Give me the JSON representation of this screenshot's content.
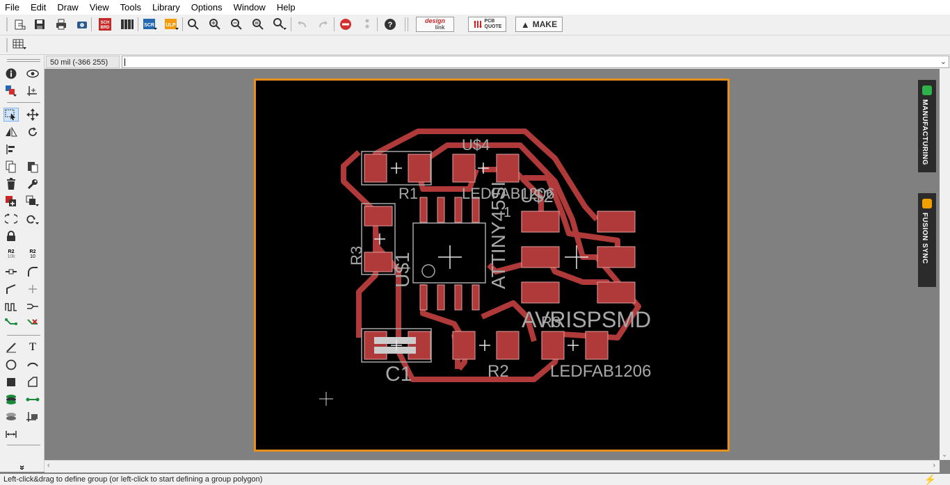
{
  "menu": [
    "File",
    "Edit",
    "Draw",
    "View",
    "Tools",
    "Library",
    "Options",
    "Window",
    "Help"
  ],
  "toolbar": {
    "icons": [
      "open-icon",
      "save-icon",
      "print-icon",
      "cam-icon",
      "sch-brd-switch-icon",
      "library-icon",
      "run-script-icon",
      "run-ulp-icon",
      "zoom-fit-icon",
      "zoom-in-icon",
      "zoom-out-icon",
      "zoom-redraw-icon",
      "zoom-select-icon",
      "undo-icon",
      "redo-icon",
      "stop-icon",
      "go-icon",
      "help-icon"
    ],
    "sch_label": "SCH BRD",
    "scr_label": "SCR",
    "ulp_label": "ULP",
    "designlink_top": "design",
    "designlink_bottom": "link",
    "pcbquote_top": "PCB",
    "pcbquote_bottom": "QUOTE",
    "make_label": "MAKE"
  },
  "coord_display": "50 mil (-366 255)",
  "command_input": "",
  "status_text": "Left-click&drag to define group (or left-click to start defining a group polygon)",
  "side_panels": [
    {
      "label": "MANUFACTURING",
      "icon_color": "#2db34a"
    },
    {
      "label": "FUSION SYNC",
      "icon_color": "#f0a000"
    }
  ],
  "left_tools": {
    "small_labels": [
      "R2",
      "10k",
      "R2",
      "10"
    ],
    "text_tool": "T",
    "collapse": "»"
  },
  "board": {
    "border_color": "#e8901c",
    "copper_color": "#b03a3a",
    "silk_color": "#a8a8a8",
    "labels": {
      "u4": "U$4",
      "r1": "R1",
      "ledfab_top": "LEDFAB1206",
      "u2": "U$2",
      "attiny": "ATTINY45SI",
      "u1": "U$1",
      "r3": "R3",
      "avrisp": "AVRISPSMD",
      "r3b": "R3",
      "c1": "C1",
      "r2": "R2",
      "ledfab_bottom": "LEDFAB1206",
      "one": "1"
    }
  }
}
